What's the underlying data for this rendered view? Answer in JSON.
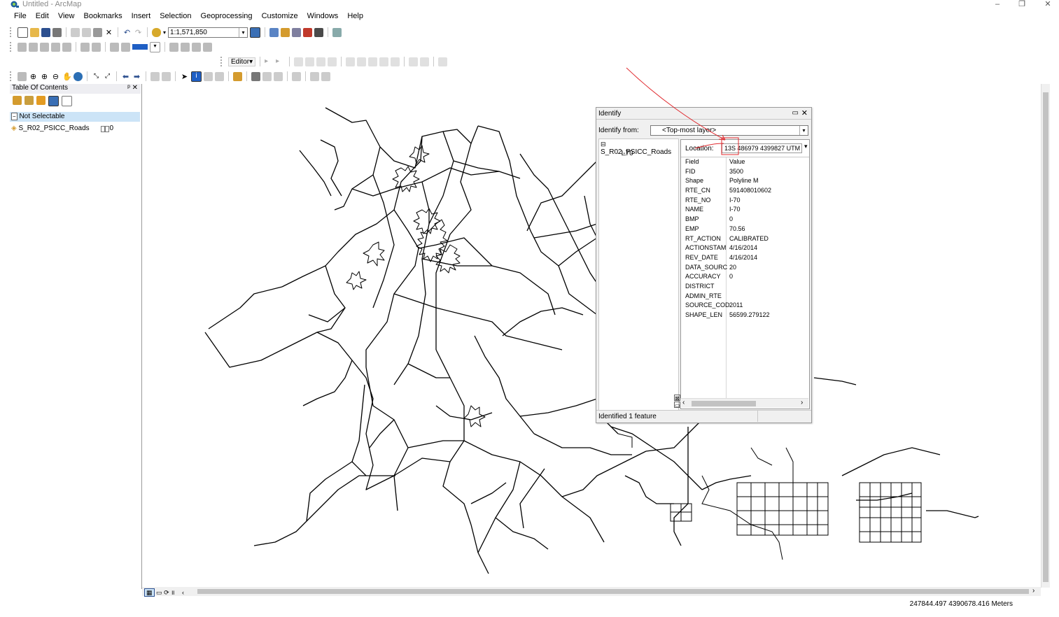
{
  "window": {
    "title": "Untitled - ArcMap",
    "minimize": "–",
    "restore": "❐",
    "close": "✕"
  },
  "menu": [
    "File",
    "Edit",
    "View",
    "Bookmarks",
    "Insert",
    "Selection",
    "Geoprocessing",
    "Customize",
    "Windows",
    "Help"
  ],
  "toolbar": {
    "scale": "1:1,571,850",
    "editor_label": "Editor▾"
  },
  "toc": {
    "title": "Table Of Contents",
    "pin": "ᵖ ✕",
    "group": "Not Selectable",
    "layer_name": "S_R02_PSICC_Roads",
    "layer_count": "0"
  },
  "identify": {
    "title": "Identify",
    "from_label": "Identify from:",
    "from_value": "<Top-most layer>",
    "tree_layer": "S_R02_PSICC_Roads",
    "tree_feature": "I-70",
    "location_label": "Location:",
    "location_value": "13S 486979 4399827  UTM",
    "header_field": "Field",
    "header_value": "Value",
    "fields": [
      {
        "f": "FID",
        "v": "3500"
      },
      {
        "f": "Shape",
        "v": "Polyline M"
      },
      {
        "f": "RTE_CN",
        "v": "591408010602"
      },
      {
        "f": "RTE_NO",
        "v": "I-70"
      },
      {
        "f": "NAME",
        "v": "I-70"
      },
      {
        "f": "BMP",
        "v": "0"
      },
      {
        "f": "EMP",
        "v": "70.56"
      },
      {
        "f": "RT_ACTION",
        "v": "CALIBRATED"
      },
      {
        "f": "ACTIONSTAM",
        "v": "4/16/2014"
      },
      {
        "f": "REV_DATE",
        "v": "4/16/2014"
      },
      {
        "f": "DATA_SOURC",
        "v": "20"
      },
      {
        "f": "ACCURACY",
        "v": "0"
      },
      {
        "f": "DISTRICT",
        "v": ""
      },
      {
        "f": "ADMIN_RTE",
        "v": ""
      },
      {
        "f": "SOURCE_COD",
        "v": "2011"
      },
      {
        "f": "SHAPE_LEN",
        "v": "56599.279122"
      }
    ],
    "status": "Identified 1 feature"
  },
  "status": {
    "coords": "247844.497  4390678.416 Meters"
  },
  "colors": {
    "annotation": "#e0282d",
    "toc_selected": "#cce4f7"
  }
}
